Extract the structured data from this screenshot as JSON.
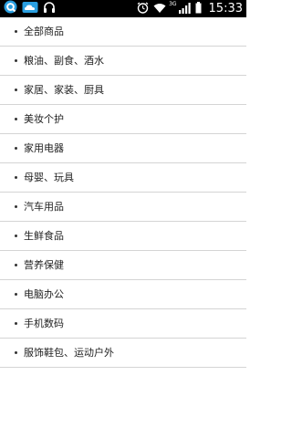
{
  "statusbar": {
    "time": "15:33",
    "network": "3G",
    "icons": [
      "app-q-icon",
      "cloud-icon",
      "headphones-icon",
      "alarm-icon",
      "wifi-icon",
      "signal-icon",
      "battery-icon"
    ],
    "colors": {
      "background": "#000000",
      "foreground": "#ffffff",
      "accent": "#2a9fe0"
    }
  },
  "categories": [
    {
      "label": "全部商品"
    },
    {
      "label": "粮油、副食、酒水"
    },
    {
      "label": "家居、家装、厨具"
    },
    {
      "label": "美妆个护"
    },
    {
      "label": "家用电器"
    },
    {
      "label": "母婴、玩具"
    },
    {
      "label": "汽车用品"
    },
    {
      "label": "生鲜食品"
    },
    {
      "label": "营养保健"
    },
    {
      "label": "电脑办公"
    },
    {
      "label": "手机数码"
    },
    {
      "label": "服饰鞋包、运动户外"
    }
  ]
}
